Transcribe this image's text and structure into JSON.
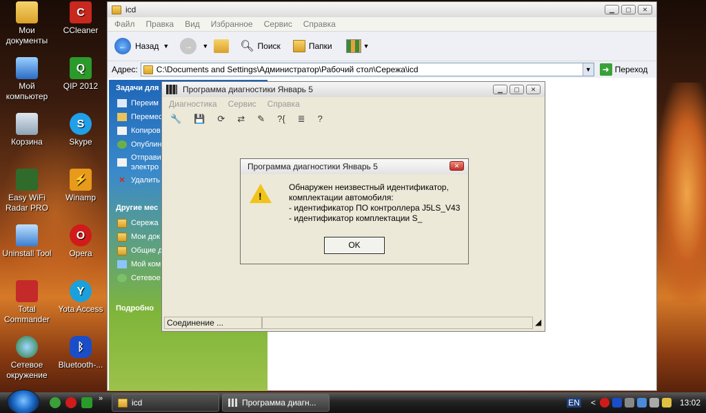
{
  "desktop": {
    "icons": [
      {
        "label": "Мои документы"
      },
      {
        "label": "CCleaner"
      },
      {
        "label": "Мой компьютер"
      },
      {
        "label": "QIP 2012"
      },
      {
        "label": "Корзина"
      },
      {
        "label": "Skype"
      },
      {
        "label": "Easy WiFi Radar PRO"
      },
      {
        "label": "Winamp"
      },
      {
        "label": "Uninstall Tool"
      },
      {
        "label": "Opera"
      },
      {
        "label": "Total Commander"
      },
      {
        "label": "Yota Access"
      },
      {
        "label": "Сетевое окружение"
      },
      {
        "label": "Bluetooth-..."
      }
    ]
  },
  "explorer": {
    "title": "icd",
    "menu": [
      "Файл",
      "Правка",
      "Вид",
      "Избранное",
      "Сервис",
      "Справка"
    ],
    "toolbar": {
      "back": "Назад",
      "search": "Поиск",
      "folders": "Папки"
    },
    "address": {
      "label": "Адрес:",
      "value": "C:\\Documents and Settings\\Администратор\\Рабочий стол\\Сережа\\icd",
      "go": "Переход"
    },
    "tasks_header": "Задачи для",
    "tasks": [
      "Переим",
      "Перемес",
      "Копиров",
      "Опублин",
      "Отправи электро",
      "Удалить"
    ],
    "places_header": "Другие мес",
    "places": [
      "Сережа",
      "Мои док",
      "Общие д",
      "Мой ком",
      "Сетевое"
    ],
    "details_header": "Подробно"
  },
  "diag": {
    "title": "Программа диагностики Январь 5",
    "menu": [
      "Диагностика",
      "Сервис",
      "Справка"
    ],
    "tools": [
      "🔧",
      "💾",
      "⟳",
      "⇄",
      "✎",
      "?{",
      "≣",
      "?"
    ],
    "status": "Соединение ..."
  },
  "dialog": {
    "title": "Программа диагностики Январь 5",
    "lines": [
      "Обнаружен неизвестный идентификатор,",
      "комплектации автомобиля:",
      "- идентификатор ПО контроллера J5LS_V43",
      "- идентификатор комплектации S_"
    ],
    "ok": "OK"
  },
  "taskbar": {
    "items": [
      {
        "label": "icd"
      },
      {
        "label": "Программа диагн..."
      }
    ],
    "lang": "EN",
    "time": "13:02"
  }
}
